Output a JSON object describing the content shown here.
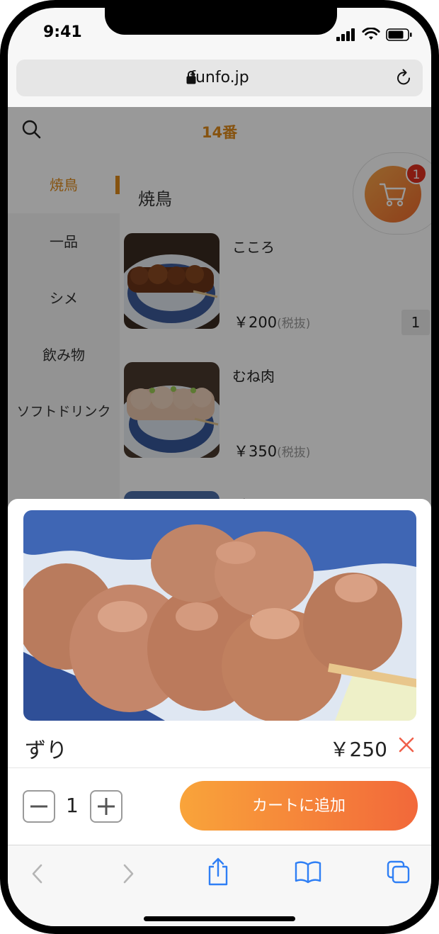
{
  "status_bar": {
    "time": "9:41"
  },
  "browser": {
    "domain": "funfo.jp"
  },
  "header": {
    "table_number": "14番"
  },
  "sidebar": {
    "categories": [
      {
        "label": "焼鳥",
        "active": true
      },
      {
        "label": "一品",
        "active": false
      },
      {
        "label": "シメ",
        "active": false
      },
      {
        "label": "飲み物",
        "active": false
      },
      {
        "label": "ソフトドリンク",
        "active": false
      }
    ]
  },
  "menu": {
    "section_title": "焼鳥",
    "items": [
      {
        "name": "こころ",
        "price": "￥200",
        "tax": "(税抜)",
        "qty": "1"
      },
      {
        "name": "むね肉",
        "price": "￥350",
        "tax": "(税抜)"
      },
      {
        "name": "ずり"
      }
    ]
  },
  "cart": {
    "count": "1"
  },
  "detail": {
    "name": "ずり",
    "price": "￥250",
    "quantity": "1",
    "add_label": "カートに追加"
  },
  "colors": {
    "accent": "#e08b1c",
    "button_start": "#f9a43a",
    "button_end": "#f2683a",
    "ios_blue": "#2f7ff5"
  }
}
